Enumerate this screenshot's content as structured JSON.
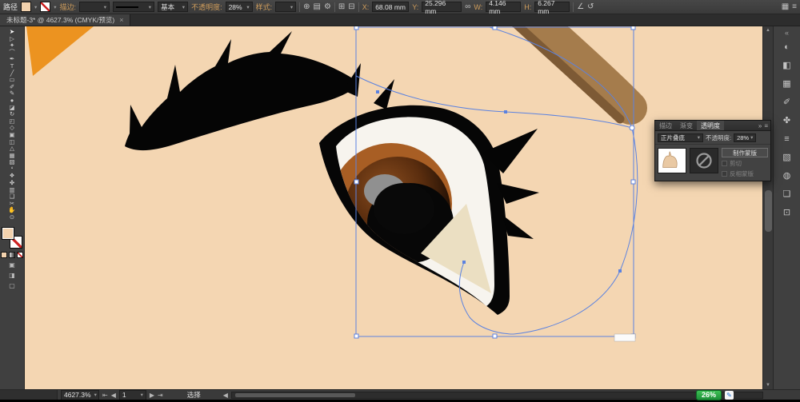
{
  "colors": {
    "ui_bg": "#3d3d3d",
    "ui_dark": "#2b2b2b",
    "canvas_bg": "#f4d6b2",
    "accent_link": "#cf9d5c",
    "selection_blue": "#5b82e0",
    "orange_shape": "#ec9320",
    "brow": "#a57c4c",
    "brow_dark": "#7d5a35",
    "iris_ring": "#a85e24",
    "iris_dark": "#2a1206",
    "pupil": "#070707",
    "highlight_gray": "#909090",
    "sclera": "#f7f4ee",
    "cream": "#ebdfc2",
    "badge_green": "#2fae3f"
  },
  "control_bar": {
    "object_label": "路径",
    "stroke_label": "描边:",
    "brush_name": "基本",
    "opacity_label": "不透明度:",
    "opacity_value": "28%",
    "style_label": "样式:",
    "x_label": "X:",
    "x_value": "68.08 mm",
    "y_label": "Y:",
    "y_value": "25.296 mm",
    "w_label": "W:",
    "w_value": "4.146 mm",
    "h_label": "H:",
    "h_value": "6.267 mm"
  },
  "tab_bar": {
    "title": "未标题-3* @ 4627.3% (CMYK/预览)",
    "close": "×"
  },
  "tools": {
    "items": [
      {
        "name": "selection-tool",
        "glyph": "➤"
      },
      {
        "name": "direct-selection-tool",
        "glyph": "▷"
      },
      {
        "name": "magic-wand-tool",
        "glyph": "✦"
      },
      {
        "name": "lasso-tool",
        "glyph": "⌒"
      },
      {
        "name": "pen-tool",
        "glyph": "✒"
      },
      {
        "name": "type-tool",
        "glyph": "T"
      },
      {
        "name": "line-tool",
        "glyph": "╱"
      },
      {
        "name": "rectangle-tool",
        "glyph": "▭"
      },
      {
        "name": "paintbrush-tool",
        "glyph": "✐"
      },
      {
        "name": "pencil-tool",
        "glyph": "✎"
      },
      {
        "name": "blob-brush-tool",
        "glyph": "●"
      },
      {
        "name": "eraser-tool",
        "glyph": "◪"
      },
      {
        "name": "rotate-tool",
        "glyph": "↻"
      },
      {
        "name": "scale-tool",
        "glyph": "◰"
      },
      {
        "name": "width-tool",
        "glyph": "◇"
      },
      {
        "name": "free-transform-tool",
        "glyph": "▣"
      },
      {
        "name": "shape-builder-tool",
        "glyph": "◫"
      },
      {
        "name": "perspective-grid-tool",
        "glyph": "△"
      },
      {
        "name": "mesh-tool",
        "glyph": "▦"
      },
      {
        "name": "gradient-tool",
        "glyph": "▧"
      },
      {
        "name": "eyedropper-tool",
        "glyph": "❛"
      },
      {
        "name": "blend-tool",
        "glyph": "❖"
      },
      {
        "name": "symbol-sprayer-tool",
        "glyph": "✤"
      },
      {
        "name": "column-graph-tool",
        "glyph": "▥"
      },
      {
        "name": "artboard-tool",
        "glyph": "❑"
      },
      {
        "name": "slice-tool",
        "glyph": "✂"
      },
      {
        "name": "hand-tool",
        "glyph": "✋"
      },
      {
        "name": "zoom-tool",
        "glyph": "⊙"
      }
    ]
  },
  "dock": {
    "items": [
      {
        "name": "collapse-panels-icon",
        "glyph": "«"
      },
      {
        "name": "color-panel-icon",
        "glyph": "◐"
      },
      {
        "name": "color-guide-panel-icon",
        "glyph": "◧"
      },
      {
        "name": "swatches-panel-icon",
        "glyph": "▦"
      },
      {
        "name": "brushes-panel-icon",
        "glyph": "✐"
      },
      {
        "name": "symbols-panel-icon",
        "glyph": "✤"
      },
      {
        "name": "stroke-panel-icon",
        "glyph": "≡"
      },
      {
        "name": "gradient-panel-icon",
        "glyph": "▧"
      },
      {
        "name": "appearance-panel-icon",
        "glyph": "◍"
      },
      {
        "name": "layers-panel-icon",
        "glyph": "❏"
      },
      {
        "name": "artboards-panel-icon",
        "glyph": "⊡"
      }
    ]
  },
  "panel": {
    "tabs": [
      {
        "label": "描边"
      },
      {
        "label": "渐变"
      },
      {
        "label": "透明度"
      }
    ],
    "blend_mode": "正片叠底",
    "opacity_label": "不透明度:",
    "opacity_value": "28%",
    "make_mask_label": "制作蒙版",
    "clip_label": "剪切",
    "invert_label": "反相蒙版"
  },
  "status_bar": {
    "zoom_value": "4627.3%",
    "artboard_value": "1",
    "tool_label": "选择"
  },
  "tray": {
    "battery": "26%"
  },
  "icons": {
    "caret": "▾",
    "globe": "⊕",
    "doc": "▤",
    "gear": "⚙",
    "align1": "⊞",
    "align2": "⊟",
    "link": "∞",
    "shear": "∠",
    "rotate": "↺",
    "arrange": "▦",
    "menu": "≡",
    "expand": "»",
    "first": "⇤",
    "prev": "◀",
    "next": "▶",
    "last": "⇥",
    "up": "▲",
    "down": "▼",
    "swap": "⇄",
    "default_colors": "◱",
    "mode1": "▣",
    "mode2": "◨",
    "screen_mode": "▢",
    "tray_pen": "✎"
  }
}
